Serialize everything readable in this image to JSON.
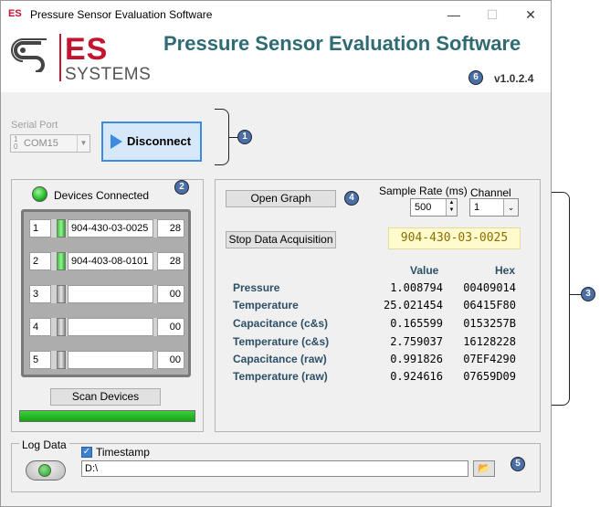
{
  "window": {
    "app_icon": "ES",
    "title": "Pressure Sensor Evaluation Software",
    "minimize_icon": "minimize-icon",
    "maximize_icon": "maximize-icon",
    "close_icon": "close-icon"
  },
  "header": {
    "logo_es": "ES",
    "logo_systems": "SYSTEMS",
    "app_title": "Pressure Sensor Evaluation Software",
    "version": "v1.0.2.4",
    "version_badge": "6"
  },
  "connection": {
    "serial_port_label": "Serial Port",
    "port_value": "COM15",
    "disconnect_label": "Disconnect",
    "badge": "1"
  },
  "devices": {
    "header_label": "Devices Connected",
    "badge": "2",
    "rows": [
      {
        "index": "1",
        "serial": "904-430-03-0025",
        "address": "28",
        "active": true
      },
      {
        "index": "2",
        "serial": "904-403-08-0101",
        "address": "28",
        "active": true
      },
      {
        "index": "3",
        "serial": "",
        "address": "00",
        "active": false
      },
      {
        "index": "4",
        "serial": "",
        "address": "00",
        "active": false
      },
      {
        "index": "5",
        "serial": "",
        "address": "00",
        "active": false
      }
    ],
    "scan_label": "Scan Devices",
    "scan_progress": 1.0
  },
  "acquisition": {
    "open_graph_label": "Open Graph",
    "badge_graph": "4",
    "sample_rate_label": "Sample Rate (ms)",
    "sample_rate_value": "500",
    "channel_label": "Channel",
    "channel_value": "1",
    "stop_label": "Stop Data Acquisition",
    "selected_serial": "904-430-03-0025",
    "badge_panel": "3",
    "col_value": "Value",
    "col_hex": "Hex",
    "readings": [
      {
        "label": "Pressure",
        "value": "1.008794",
        "hex": "00409014"
      },
      {
        "label": "Temperature",
        "value": "25.021454",
        "hex": "06415F80"
      },
      {
        "label": "Capacitance (c&s)",
        "value": "0.165599",
        "hex": "0153257B"
      },
      {
        "label": "Temperature (c&s)",
        "value": "2.759037",
        "hex": "16128228"
      },
      {
        "label": "Capacitance (raw)",
        "value": "0.991826",
        "hex": "07EF4290"
      },
      {
        "label": "Temperature (raw)",
        "value": "0.924616",
        "hex": "07659D09"
      }
    ]
  },
  "log": {
    "group_label": "Log Data",
    "timestamp_label": "Timestamp",
    "timestamp_checked": true,
    "path_value": "D:\\",
    "badge": "5"
  }
}
